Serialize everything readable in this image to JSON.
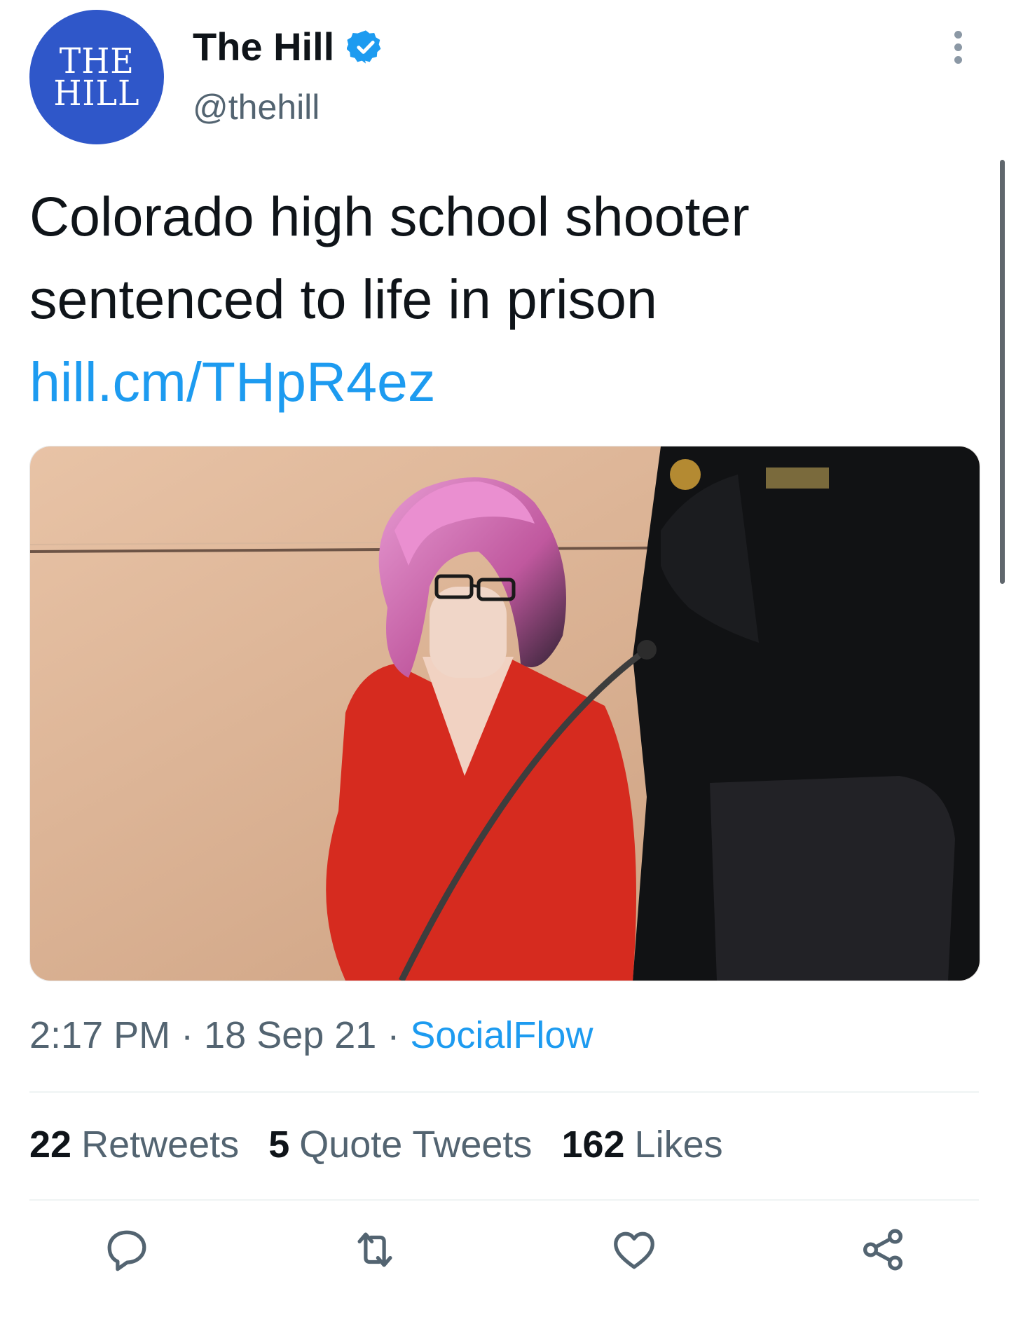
{
  "tweet": {
    "avatar": {
      "line1": "THE",
      "line2": "HILL",
      "color": "#2f57c9"
    },
    "display_name": "The Hill",
    "handle": "@thehill",
    "text": "Colorado high school shooter sentenced to life in prison",
    "link": "hill.cm/THpR4ez",
    "image": {
      "description": "photo"
    },
    "time": "2:17 PM",
    "date": "18 Sep 21",
    "separator": "·",
    "source": "SocialFlow",
    "stats": {
      "retweets_count": "22",
      "retweets_label": "Retweets",
      "quotes_count": "5",
      "quotes_label": "Quote Tweets",
      "likes_count": "162",
      "likes_label": "Likes"
    },
    "actions": [
      "reply-icon",
      "retweet-icon",
      "like-icon",
      "share-icon"
    ],
    "colors": {
      "link": "#1d9bf0",
      "secondary": "#536471",
      "verified": "#1d9bf0"
    }
  }
}
